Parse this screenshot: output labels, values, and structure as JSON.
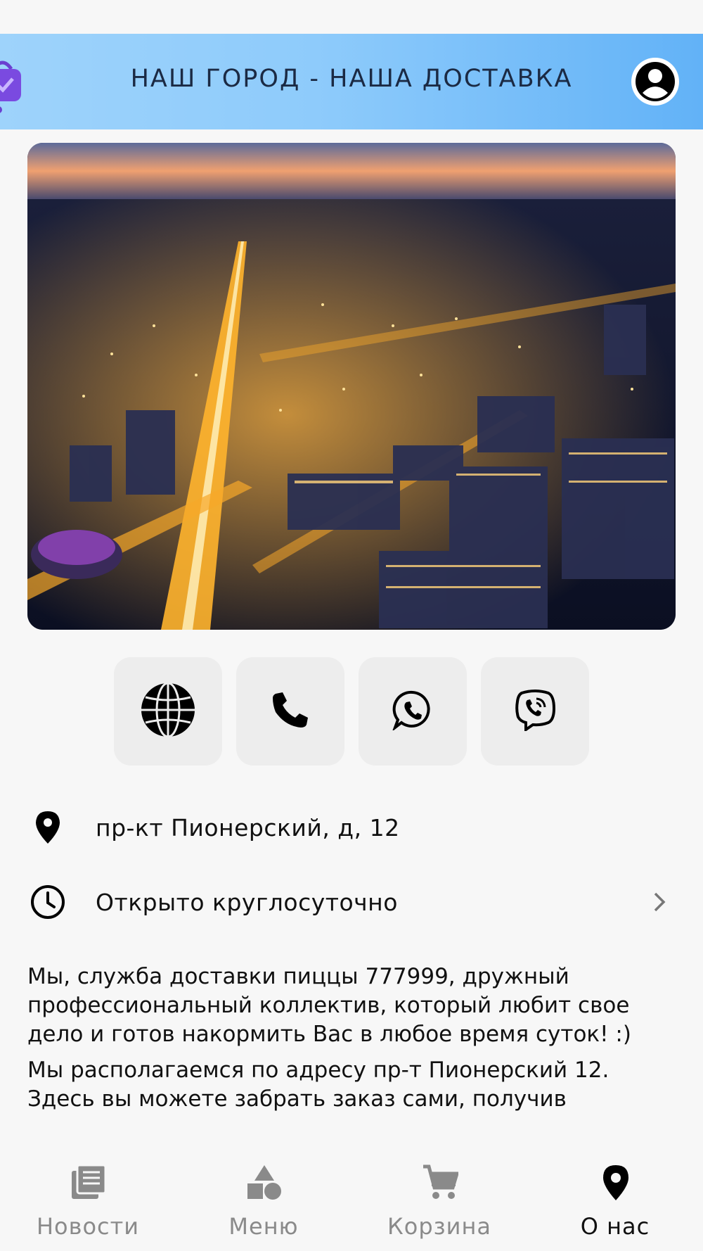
{
  "header": {
    "title": "НАШ ГОРОД -  НАША ДОСТАВКА",
    "logo_icon": "shopping-bag-icon",
    "profile_icon": "user-circle-icon",
    "gradient": [
      "#9ed3fb",
      "#62b2f7"
    ]
  },
  "hero": {
    "image": "night-city-aerial-photo"
  },
  "contacts": [
    {
      "name": "website",
      "icon": "globe-icon"
    },
    {
      "name": "phone",
      "icon": "phone-icon"
    },
    {
      "name": "whatsapp",
      "icon": "whatsapp-icon"
    },
    {
      "name": "viber",
      "icon": "viber-icon"
    }
  ],
  "address": {
    "icon": "map-pin-icon",
    "text": "пр-кт Пионерский, д, 12"
  },
  "hours": {
    "icon": "clock-icon",
    "text": "Открыто круглосуточно"
  },
  "about": {
    "paragraph_1": "Мы, служба доставки пиццы 777999, дружный профессиональный коллектив, который любит свое дело и готов накормить Вас в любое время суток! :)",
    "paragraph_2": "Мы располагаемся по адресу пр-т Пионерский 12. Здесь вы можете забрать заказ сами, получив"
  },
  "tabbar": {
    "tabs": [
      {
        "label": "Новости",
        "icon": "news-icon",
        "active": false
      },
      {
        "label": "Меню",
        "icon": "shapes-icon",
        "active": false
      },
      {
        "label": "Корзина",
        "icon": "cart-icon",
        "active": false
      },
      {
        "label": "О нас",
        "icon": "map-pin-icon",
        "active": true
      }
    ],
    "active_color": "#111111",
    "inactive_color": "#8a8a8a"
  }
}
